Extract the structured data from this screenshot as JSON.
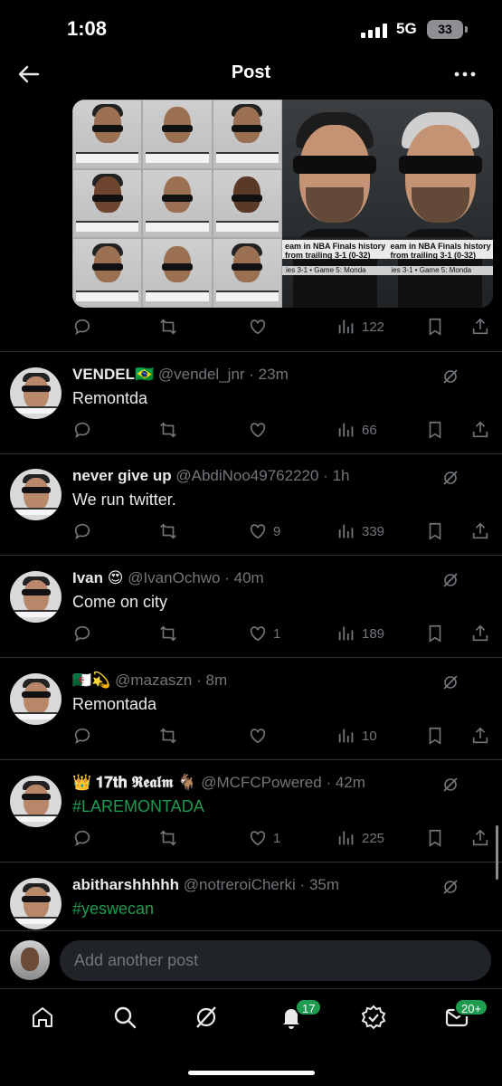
{
  "status": {
    "time": "1:08",
    "network": "5G",
    "battery": "33"
  },
  "header": {
    "title": "Post"
  },
  "media": {
    "caption_line1": "eam in NBA Finals history has come",
    "caption_line2": "from trailing 3-1 (0-32)",
    "caption_line3": "ies 3-1 • Game 5: Monda"
  },
  "main_post": {
    "views": "122"
  },
  "replies": [
    {
      "name": "VENDEL🇧🇷",
      "handle": "@vendel_jnr",
      "time": "23m",
      "text": "Remontda",
      "likes": "",
      "views": "66",
      "is_hashtag": false
    },
    {
      "name": "never give up",
      "handle": "@AbdiNoo49762220",
      "time": "1h",
      "text": "We run twitter.",
      "likes": "9",
      "views": "339",
      "is_hashtag": false
    },
    {
      "name": "Ivan 😍",
      "handle": "@IvanOchwo",
      "time": "40m",
      "text": "Come on city",
      "likes": "1",
      "views": "189",
      "is_hashtag": false
    },
    {
      "name": "🇩🇿💫",
      "handle": "@mazaszn",
      "time": "8m",
      "text": "Remontada",
      "likes": "",
      "views": "10",
      "is_hashtag": false
    },
    {
      "name": "👑 𝟏𝟕𝐭𝐡 𝕽𝖊𝖆𝖑𝖒 🐐",
      "handle": "@MCFCPowered",
      "time": "42m",
      "text": "#LAREMONTADA",
      "likes": "1",
      "views": "225",
      "is_hashtag": true
    },
    {
      "name": "abitharshhhhh",
      "handle": "@notreroiCherki",
      "time": "35m",
      "text": "#yeswecan",
      "likes": "",
      "views": "",
      "is_hashtag": true
    }
  ],
  "compose": {
    "placeholder": "Add another post"
  },
  "tabbar": {
    "notifications_badge": "17",
    "messages_badge": "20+"
  },
  "colors": {
    "background": "#000000",
    "text": "#e7e9ea",
    "muted": "#71767b",
    "accent": "#1d9b4f"
  }
}
